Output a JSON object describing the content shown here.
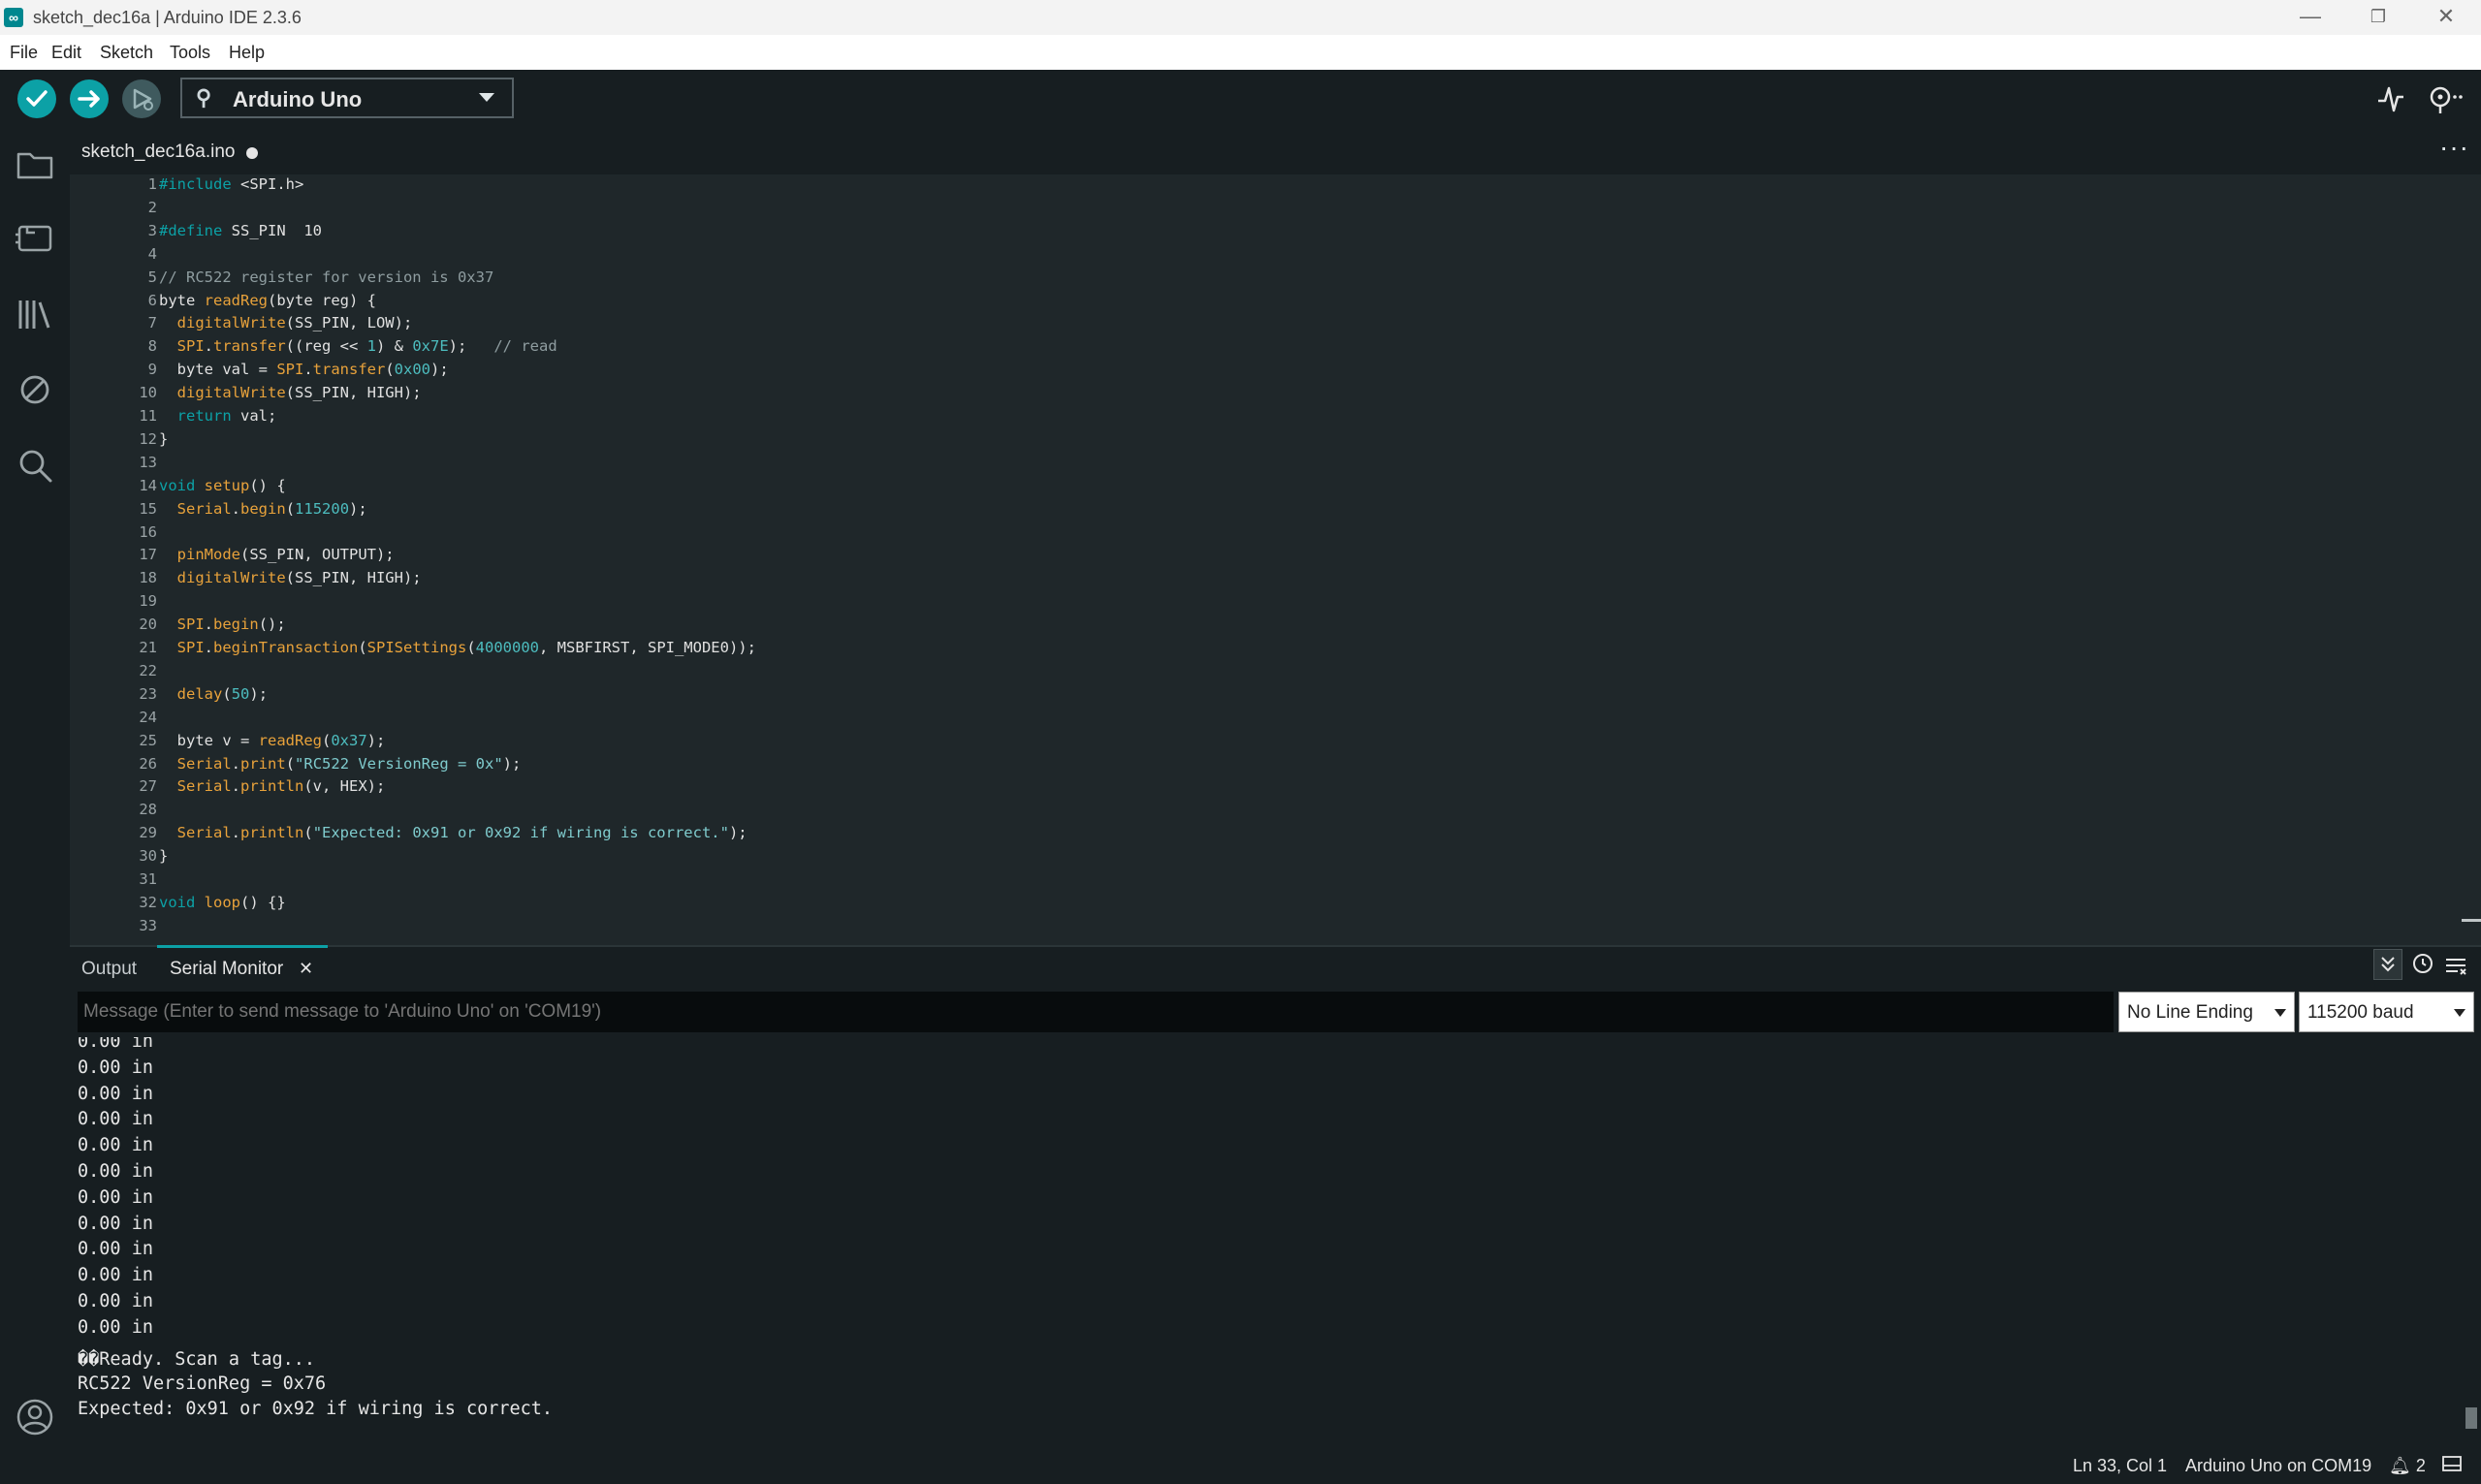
{
  "window": {
    "title": "sketch_dec16a | Arduino IDE 2.3.6",
    "logo": "∞",
    "minimize": "—",
    "maximize": "❐",
    "close": "✕"
  },
  "menu": [
    "File",
    "Edit",
    "Sketch",
    "Tools",
    "Help"
  ],
  "toolbar": {
    "verify_icon": "check-icon",
    "upload_icon": "arrow-right-icon",
    "debug_icon": "debug-icon",
    "board": "Arduino Uno",
    "usb_icon": "usb-icon",
    "serial_plotter_icon": "pulse-icon",
    "serial_monitor_icon": "magnifier-dots-icon"
  },
  "sidebar": [
    "folder-icon",
    "board-icon",
    "library-icon",
    "debug-off-icon",
    "search-icon",
    "account-icon"
  ],
  "editor": {
    "file_tab": "sketch_dec16a.ino",
    "more": "···",
    "lines": [
      "#include <SPI.h>",
      "",
      "#define SS_PIN  10",
      "",
      "// RC522 register for version is 0x37",
      "byte readReg(byte reg) {",
      "  digitalWrite(SS_PIN, LOW);",
      "  SPI.transfer((reg << 1) & 0x7E);   // read",
      "  byte val = SPI.transfer(0x00);",
      "  digitalWrite(SS_PIN, HIGH);",
      "  return val;",
      "}",
      "",
      "void setup() {",
      "  Serial.begin(115200);",
      "",
      "  pinMode(SS_PIN, OUTPUT);",
      "  digitalWrite(SS_PIN, HIGH);",
      "",
      "  SPI.begin();",
      "  SPI.beginTransaction(SPISettings(4000000, MSBFIRST, SPI_MODE0));",
      "",
      "  delay(50);",
      "",
      "  byte v = readReg(0x37);",
      "  Serial.print(\"RC522 VersionReg = 0x\");",
      "  Serial.println(v, HEX);",
      "",
      "  Serial.println(\"Expected: 0x91 or 0x92 if wiring is correct.\");",
      "}",
      "",
      "void loop() {}",
      ""
    ]
  },
  "panel": {
    "tab_output": "Output",
    "tab_serial": "Serial Monitor",
    "tab_close": "✕",
    "message_placeholder": "Message (Enter to send message to 'Arduino Uno' on 'COM19')",
    "line_ending": "No Line Ending",
    "baud": "115200 baud",
    "output_lines": [
      "0.00 in",
      "0.00 in",
      "0.00 in",
      "0.00 in",
      "0.00 in",
      "0.00 in",
      "0.00 in",
      "0.00 in",
      "0.00 in",
      "0.00 in",
      "0.00 in",
      "0.00 in",
      "��Ready. Scan a tag...",
      "RC522 VersionReg = 0x76",
      "Expected: 0x91 or 0x92 if wiring is correct."
    ]
  },
  "status": {
    "position": "Ln 33, Col 1",
    "board_port": "Arduino Uno on COM19",
    "notifications": "2"
  },
  "colors": {
    "accent": "#0ca1a6",
    "background": "#171e21",
    "editor_bg": "#1f272a"
  }
}
